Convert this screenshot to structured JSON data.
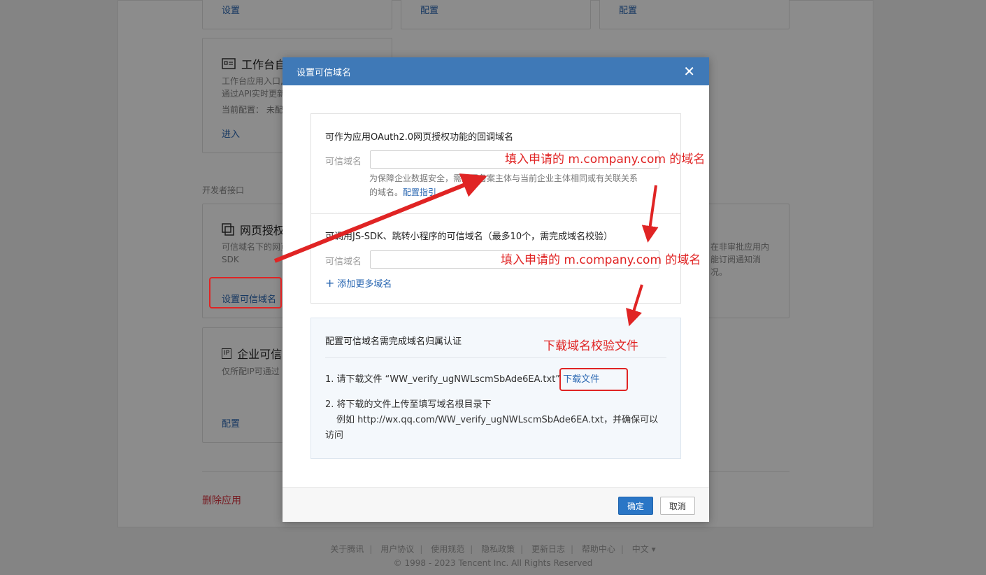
{
  "background": {
    "top_cards": [
      {
        "link": "设置"
      },
      {
        "link": "配置"
      },
      {
        "link": "配置"
      }
    ],
    "workbench_card": {
      "title": "工作台自",
      "desc_line1": "工作台应用入口,",
      "desc_line2": "通过API实时更新",
      "config_label": "当前配置：  未配",
      "link": "进入"
    },
    "section_label": "开发者接口",
    "web_auth_card": {
      "title": "网页授权",
      "desc_line1": "可信域名下的网页",
      "desc_line2": "SDK",
      "link": "设置可信域名"
    },
    "right_card": {
      "desc_line1": "在非审批应用内",
      "desc_line2": "能订阅通知消",
      "desc_line3": "况。"
    },
    "ip_card": {
      "icon_text": "IP",
      "title": "企业可信",
      "desc": "仅所配IP可通过",
      "link": "配置"
    },
    "delete_app": "删除应用"
  },
  "footer": {
    "links": [
      "关于腾讯",
      "用户协议",
      "使用规范",
      "隐私政策",
      "更新日志",
      "帮助中心",
      "中文 ▾"
    ],
    "copyright": "© 1998 - 2023 Tencent Inc. All Rights Reserved"
  },
  "dialog": {
    "title": "设置可信域名",
    "close": "✕",
    "oauth_section": {
      "title": "可作为应用OAuth2.0网页授权功能的回调域名",
      "field_label": "可信域名",
      "input_value": "",
      "hint_line1": "为保障企业数据安全，需配置备案主体与当前企业主体相同或有关联关系",
      "hint_line2": "的域名。",
      "hint_link": "配置指引"
    },
    "jssdk_section": {
      "title": "可调用JS-SDK、跳转小程序的可信域名（最多10个，需完成域名校验）",
      "field_label": "可信域名",
      "input_value": "",
      "add_more": "添加更多域名"
    },
    "verify_section": {
      "title": "配置可信域名需完成域名归属认证",
      "step1_text": "1. 请下载文件 “WW_verify_ugNWLscmSbAde6EA.txt”",
      "step1_link": "下载文件",
      "step2_line1": "2. 将下载的文件上传至填写域名根目录下",
      "step2_line2": "例如 http://wx.qq.com/WW_verify_ugNWLscmSbAde6EA.txt，并确保可以",
      "step2_line3": "访问"
    },
    "ok_button": "确定",
    "cancel_button": "取消"
  },
  "annotations": {
    "fill_domain_1": "填入申请的 m.company.com 的域名",
    "fill_domain_2": "填入申请的 m.company.com 的域名",
    "download_file": "下载域名校验文件",
    "color": "#e02424"
  }
}
